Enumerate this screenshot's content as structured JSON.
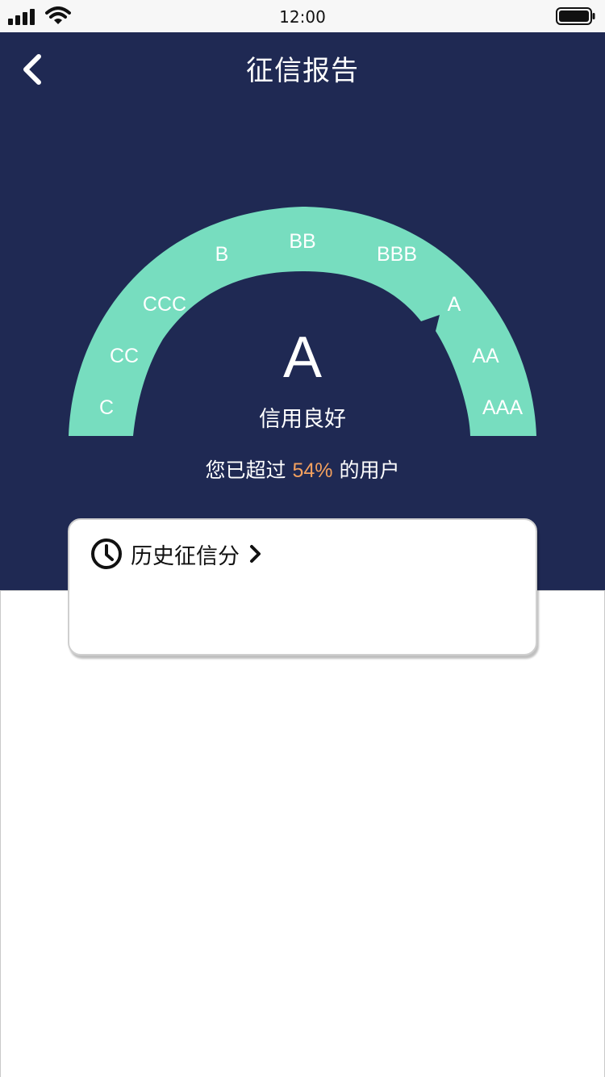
{
  "status_bar": {
    "time": "12:00",
    "icons": [
      "signal-icon",
      "wifi-icon",
      "battery-icon"
    ]
  },
  "header": {
    "title": "征信报告",
    "back_icon": "chevron-left-icon"
  },
  "gauge": {
    "grades": [
      "C",
      "CC",
      "CCC",
      "B",
      "BB",
      "BBB",
      "A",
      "AA",
      "AAA"
    ],
    "current_grade": "A",
    "description": "信用良好",
    "colors": {
      "arc": "#77ddbf",
      "background": "#1f2953",
      "text": "#ffffff"
    }
  },
  "ranking": {
    "prefix": "您已超过",
    "percent": "54%",
    "suffix": "的用户",
    "percent_color": "#f3a05e"
  },
  "history_card": {
    "icon": "clock-icon",
    "label": "历史征信分",
    "chevron": "chevron-right-icon"
  }
}
